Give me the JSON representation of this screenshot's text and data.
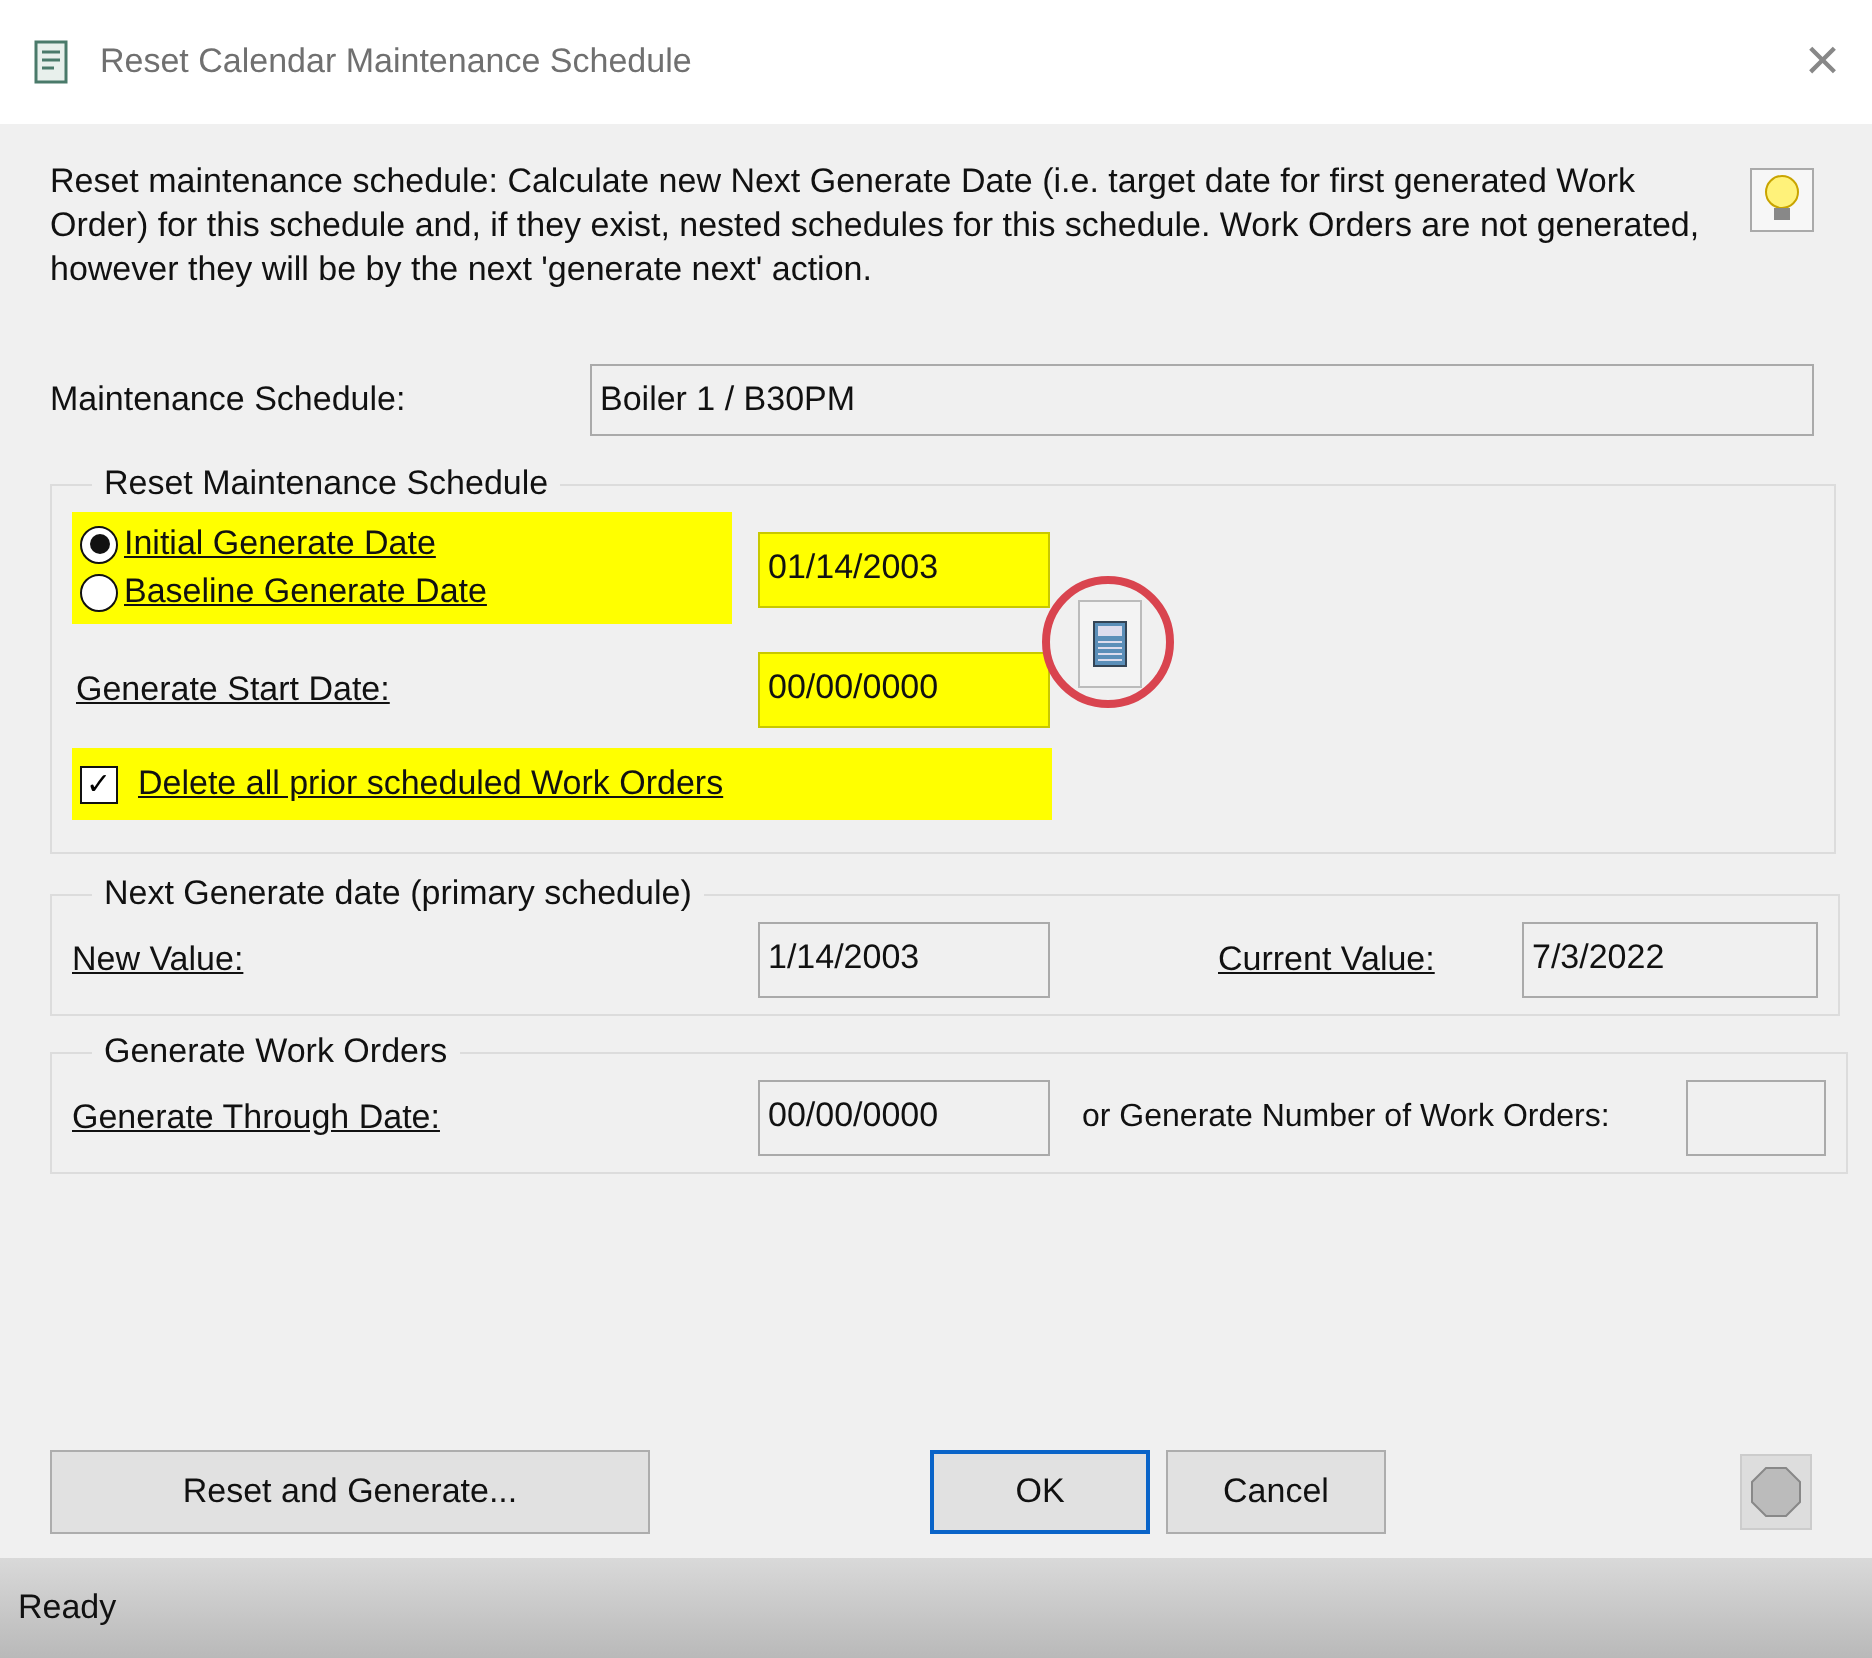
{
  "window": {
    "title": "Reset Calendar Maintenance Schedule",
    "close": "×"
  },
  "description": "Reset maintenance schedule: Calculate new Next Generate Date (i.e. target date for first generated Work Order) for this schedule and, if they exist, nested schedules for this schedule.  Work Orders are not generated, however they will be by the next 'generate next' action.",
  "maintenance_schedule": {
    "label": "Maintenance Schedule:",
    "value": "Boiler 1 / B30PM"
  },
  "reset_group": {
    "title": "Reset Maintenance Schedule",
    "options": [
      {
        "label": "Initial Generate Date",
        "selected": true
      },
      {
        "label": "Baseline Generate Date",
        "selected": false
      }
    ],
    "options_highlighted": true,
    "date_field": {
      "value": "01/14/2003",
      "highlighted": true
    },
    "calculator_circled": true,
    "start_date": {
      "label": "Generate Start Date:",
      "value": "00/00/0000",
      "highlighted": true
    },
    "delete_prior": {
      "label": "Delete all prior scheduled Work Orders",
      "checked": true,
      "check_mark": "✓",
      "highlighted": true
    }
  },
  "next_generate_group": {
    "title": "Next Generate date (primary schedule)",
    "new_value_label": "New Value:",
    "new_value": "1/14/2003",
    "current_value_label": "Current Value:",
    "current_value": "7/3/2022"
  },
  "generate_group": {
    "title": "Generate Work Orders",
    "through_label": "Generate Through Date:",
    "through_value": "00/00/0000",
    "number_label": "or Generate Number of Work Orders:"
  },
  "buttons": [
    {
      "label": "Reset and Generate...",
      "kind": "wide",
      "default": false
    },
    {
      "label": "OK",
      "kind": "normal",
      "default": true
    },
    {
      "label": "Cancel",
      "kind": "normal",
      "default": false
    }
  ],
  "status_bar": "Ready"
}
